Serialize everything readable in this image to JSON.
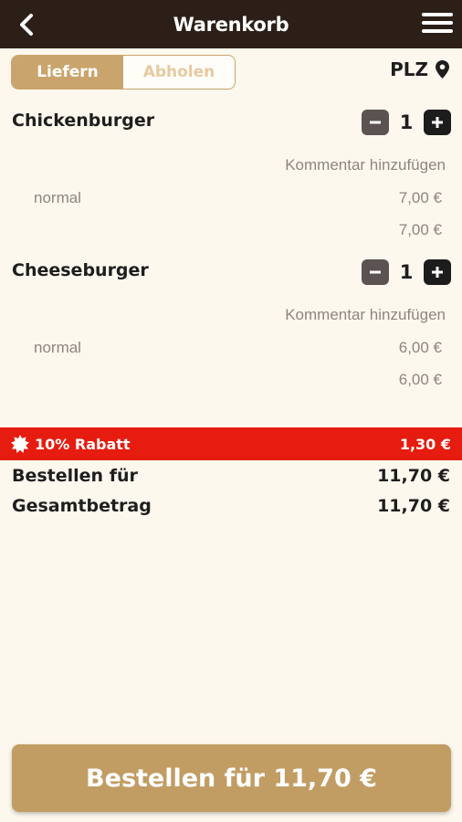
{
  "header": {
    "title": "Warenkorb",
    "back_icon": "chevron-left-icon",
    "menu_icon": "hamburger-menu-icon",
    "background": "#2b1f17"
  },
  "delivery_toggle": {
    "options": [
      "Liefern",
      "Abholen"
    ],
    "selected": "Liefern"
  },
  "postcode": {
    "label": "PLZ",
    "icon": "location-pin-icon"
  },
  "cart_items": [
    {
      "name": "Chickenburger",
      "quantity": "1",
      "comment_link": "Kommentar hinzufügen",
      "variant": "normal",
      "variant_price": "7,00 €",
      "item_total": "7,00 €"
    },
    {
      "name": "Cheeseburger",
      "quantity": "1",
      "comment_link": "Kommentar hinzufügen",
      "variant": "normal",
      "variant_price": "6,00 €",
      "item_total": "6,00 €"
    }
  ],
  "discount": {
    "label": "10% Rabatt",
    "amount": "1,30 €",
    "icon": "badge-burst-icon",
    "color": "#e51c0f"
  },
  "summary": {
    "order_for_label": "Bestellen für",
    "order_for_value": "11,70 €",
    "total_label": "Gesamtbetrag",
    "total_value": "11,70 €"
  },
  "order_button": {
    "label": "Bestellen für 11,70 €",
    "color": "#c19d64"
  },
  "accent_color": "#c9a46c"
}
